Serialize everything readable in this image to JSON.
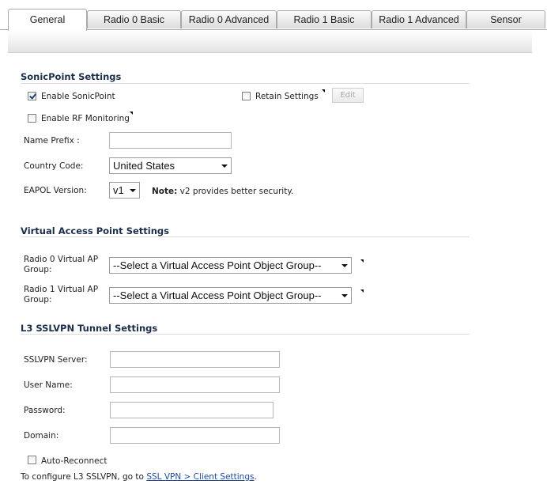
{
  "tabs": [
    {
      "label": "General",
      "active": true
    },
    {
      "label": "Radio 0 Basic",
      "active": false
    },
    {
      "label": "Radio 0 Advanced",
      "active": false
    },
    {
      "label": "Radio 1 Basic",
      "active": false
    },
    {
      "label": "Radio 1 Advanced",
      "active": false
    },
    {
      "label": "Sensor",
      "active": false
    }
  ],
  "sonicpoint": {
    "title": "SonicPoint Settings",
    "enable_sonicpoint": {
      "label": "Enable SonicPoint",
      "checked": true
    },
    "retain_settings": {
      "label": "Retain Settings",
      "checked": false
    },
    "edit_button": "Edit",
    "enable_rf_monitoring": {
      "label": "Enable RF Monitoring",
      "checked": false
    },
    "name_prefix": {
      "label": "Name Prefix :",
      "value": ""
    },
    "country_code": {
      "label": "Country Code:",
      "value": "United States"
    },
    "eapol_version": {
      "label": "EAPOL Version:",
      "value": "v1"
    },
    "note_bold": "Note:",
    "note_text": " v2 provides better security."
  },
  "vap": {
    "title": "Virtual Access Point Settings",
    "radio0": {
      "label": "Radio 0 Virtual AP Group:",
      "value": "--Select a Virtual Access Point Object Group--"
    },
    "radio1": {
      "label": "Radio 1 Virtual AP Group:",
      "value": "--Select a Virtual Access Point Object Group--"
    }
  },
  "l3": {
    "title": "L3 SSLVPN Tunnel Settings",
    "server": {
      "label": "SSLVPN Server:",
      "value": ""
    },
    "username": {
      "label": "User Name:",
      "value": ""
    },
    "password": {
      "label": "Password:",
      "value": ""
    },
    "domain": {
      "label": "Domain:",
      "value": ""
    },
    "auto_reconnect": {
      "label": "Auto-Reconnect",
      "checked": false
    },
    "footer_prefix": "To configure L3 SSLVPN, go to ",
    "footer_link": "SSL VPN > Client Settings",
    "footer_suffix": "."
  }
}
